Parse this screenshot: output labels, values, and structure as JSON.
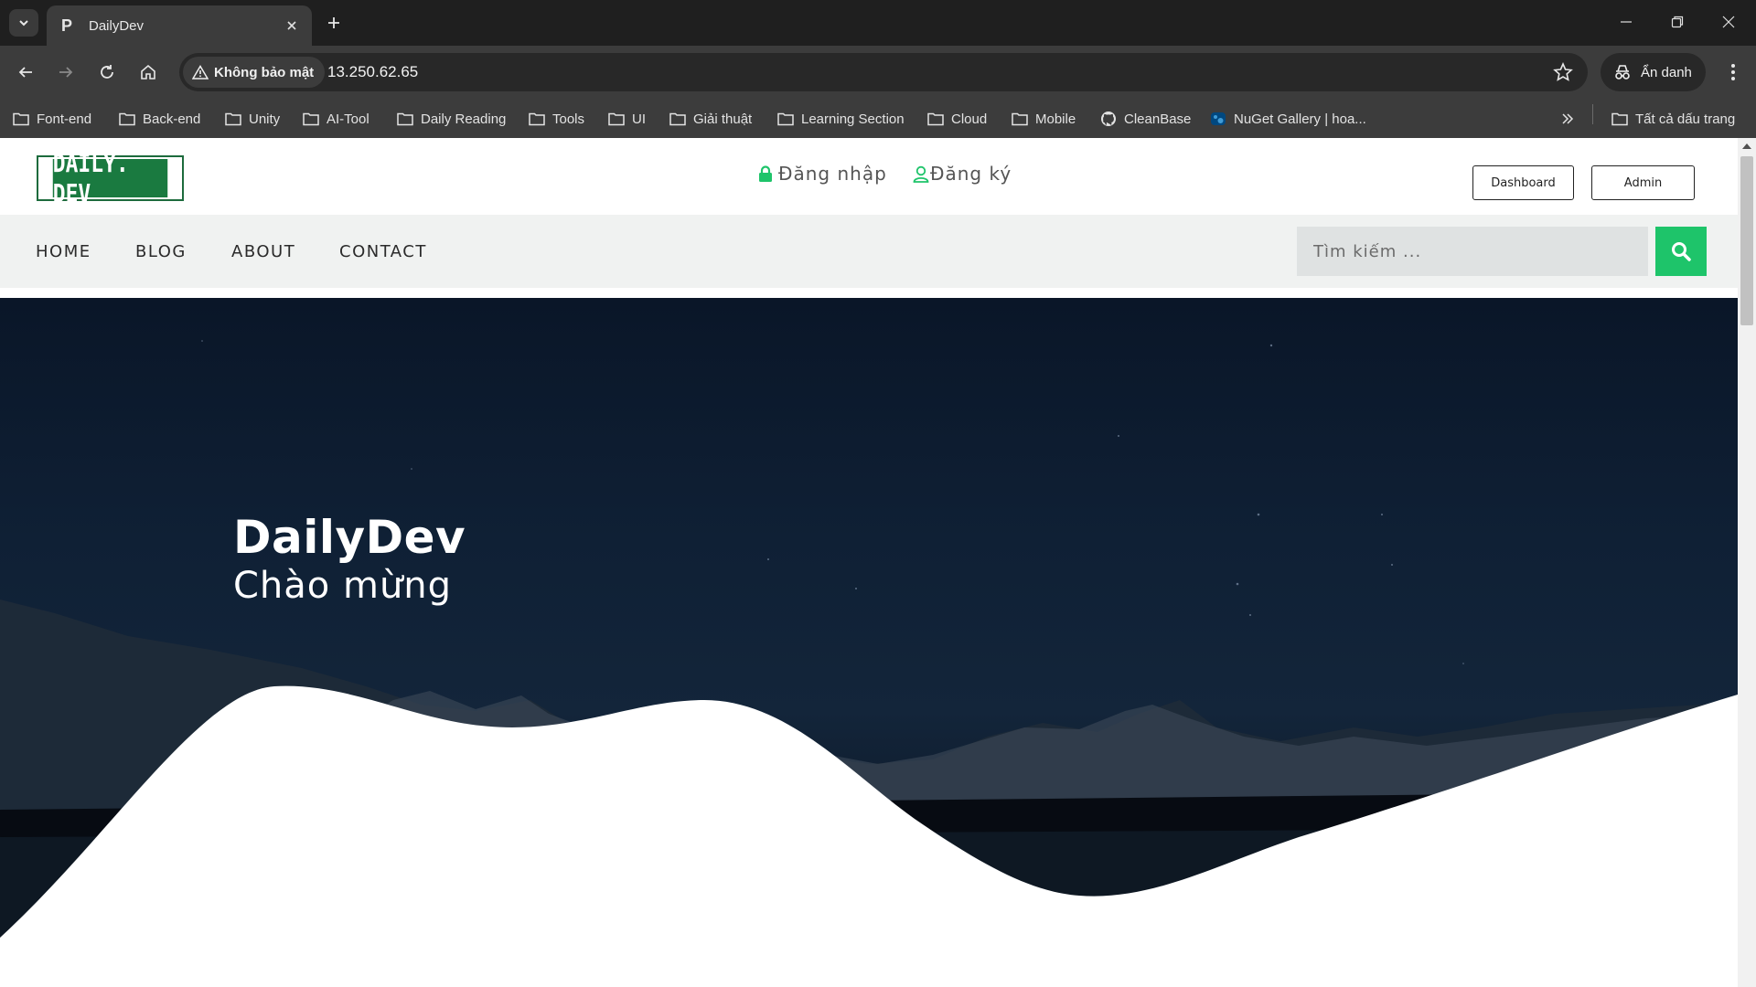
{
  "browser": {
    "tab_title": "DailyDev",
    "tab_favicon": "P",
    "security_label": "Không bảo mật",
    "url": "13.250.62.65",
    "incognito_label": "Ẩn danh",
    "bookmarks": [
      {
        "label": "Font-end",
        "icon": "folder-icon"
      },
      {
        "label": "Back-end",
        "icon": "folder-icon"
      },
      {
        "label": "Unity",
        "icon": "folder-icon"
      },
      {
        "label": "AI-Tool",
        "icon": "folder-icon"
      },
      {
        "label": "Daily Reading",
        "icon": "folder-icon"
      },
      {
        "label": "Tools",
        "icon": "folder-icon"
      },
      {
        "label": "UI",
        "icon": "folder-icon"
      },
      {
        "label": "Giải thuật",
        "icon": "folder-icon"
      },
      {
        "label": "Learning Section",
        "icon": "folder-icon"
      },
      {
        "label": "Cloud",
        "icon": "folder-icon"
      },
      {
        "label": "Mobile",
        "icon": "folder-icon"
      },
      {
        "label": "CleanBase",
        "icon": "github-icon"
      },
      {
        "label": "NuGet Gallery | hoa...",
        "icon": "nuget-icon"
      }
    ],
    "all_bookmarks_label": "Tất cả dấu trang"
  },
  "site": {
    "logo_text": "DAILY. DEV",
    "login_label": "Đăng nhập",
    "register_label": "Đăng ký",
    "dashboard_label": "Dashboard",
    "admin_label": "Admin",
    "nav": [
      "HOME",
      "BLOG",
      "ABOUT",
      "CONTACT"
    ],
    "search_placeholder": "Tìm kiếm ...",
    "hero_title": "DailyDev",
    "hero_subtitle": "Chào mừng",
    "colors": {
      "accent": "#1ec46a",
      "logo_green": "#1a7a40"
    }
  }
}
